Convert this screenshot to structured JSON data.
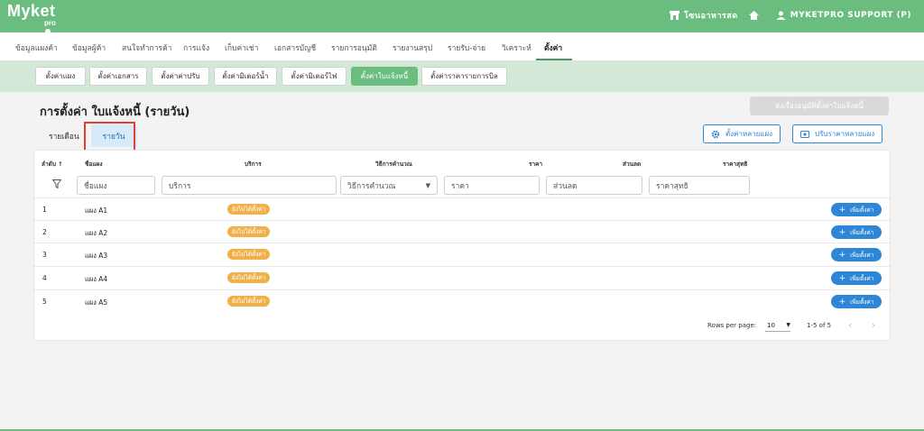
{
  "header": {
    "logo": "Myket",
    "logo_sub": "pro",
    "store_name": "โซนอาหารสด",
    "user": "MYKETPRO SUPPORT (P)"
  },
  "menu": [
    {
      "label": "ข้อมูลแผงค้า",
      "active": false
    },
    {
      "label": "ข้อมูลผู้ค้า",
      "active": false
    },
    {
      "label": "สนใจทำการค้า",
      "active": false
    },
    {
      "label": "การแจ้ง",
      "active": false
    },
    {
      "label": "เก็บค่าเช่า",
      "active": false
    },
    {
      "label": "เอกสารบัญชี",
      "active": false
    },
    {
      "label": "รายการอนุมัติ",
      "active": false
    },
    {
      "label": "รายงานสรุป",
      "active": false
    },
    {
      "label": "รายรับ-จ่าย",
      "active": false
    },
    {
      "label": "วิเคราะห์",
      "active": false
    },
    {
      "label": "ตั้งค่า",
      "active": true
    }
  ],
  "subtabs": [
    {
      "label": "ตั้งค่าแผง",
      "active": false
    },
    {
      "label": "ตั้งค่าเอกสาร",
      "active": false
    },
    {
      "label": "ตั้งค่าค่าปรับ",
      "active": false
    },
    {
      "label": "ตั้งค่ามิเตอร์น้ำ",
      "active": false
    },
    {
      "label": "ตั้งค่ามิเตอร์ไฟ",
      "active": false
    },
    {
      "label": "ตั้งค่าใบแจ้งหนี้",
      "active": true
    },
    {
      "label": "ตั้งค่าราคารายการบิล",
      "active": false
    }
  ],
  "page": {
    "title": "การตั้งค่า ใบแจ้งหนี้ (รายวัน)",
    "approve_button": "ส่งเรื่องอนุมัติตั้งค่าใบแจ้งหนี้",
    "period_tabs": [
      "รายเดือน",
      "รายวัน"
    ],
    "active_period": "รายวัน",
    "bulk_setting_button": "ตั้งค่าหลายแผง",
    "bulk_price_button": "ปรับราคาหลายแผง"
  },
  "table": {
    "columns": [
      "ลำดับ ↑",
      "ชื่อแผง",
      "บริการ",
      "วิธีการคำนวณ",
      "ราคา",
      "ส่วนลด",
      "ราคาสุทธิ"
    ],
    "filters": {
      "name": "ชื่อแผง",
      "service": "บริการ",
      "method": "วิธีการคำนวณ",
      "price": "ราคา",
      "discount": "ส่วนลด",
      "net": "ราคาสุทธิ"
    },
    "rows": [
      {
        "no": "1",
        "name": "แผง A1",
        "status": "ยังไม่ได้ตั้งค่า",
        "action": "เพิ่มตั้งค่า"
      },
      {
        "no": "2",
        "name": "แผง A2",
        "status": "ยังไม่ได้ตั้งค่า",
        "action": "เพิ่มตั้งค่า"
      },
      {
        "no": "3",
        "name": "แผง A3",
        "status": "ยังไม่ได้ตั้งค่า",
        "action": "เพิ่มตั้งค่า"
      },
      {
        "no": "4",
        "name": "แผง A4",
        "status": "ยังไม่ได้ตั้งค่า",
        "action": "เพิ่มตั้งค่า"
      },
      {
        "no": "5",
        "name": "แผง A5",
        "status": "ยังไม่ได้ตั้งค่า",
        "action": "เพิ่มตั้งค่า"
      }
    ]
  },
  "pagination": {
    "rows_per_page_label": "Rows per page:",
    "rows_per_page": "10",
    "range": "1-5 of 5"
  },
  "colors": {
    "primary_green": "#6bbd7f",
    "sub_green": "#d3e8d6",
    "blue": "#2e86d6",
    "badge_orange": "#f0b04a",
    "highlight_red": "#e0402f"
  }
}
